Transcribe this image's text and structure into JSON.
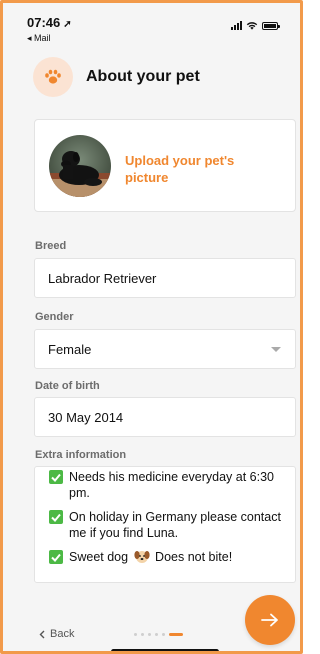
{
  "status_bar": {
    "time": "07:46",
    "back_app": "◂ Mail"
  },
  "header": {
    "title": "About your pet",
    "icon": "paw-icon"
  },
  "upload": {
    "label": "Upload your pet's picture"
  },
  "form": {
    "breed": {
      "label": "Breed",
      "value": "Labrador Retriever"
    },
    "gender": {
      "label": "Gender",
      "value": "Female"
    },
    "dob": {
      "label": "Date of birth",
      "value": "30 May 2014"
    },
    "extra": {
      "label": "Extra information",
      "notes": [
        "Needs his medicine everyday at 6:30 pm.",
        "On holiday in Germany please contact me if you find Luna."
      ],
      "note3_before": "Sweet dog",
      "note3_after": "Does not bite!"
    }
  },
  "footer": {
    "back_label": "Back",
    "progress_dots_total": 6,
    "progress_active_index": 5
  },
  "colors": {
    "accent": "#f0872f",
    "check": "#4cb945",
    "frame": "#f29a4a"
  }
}
